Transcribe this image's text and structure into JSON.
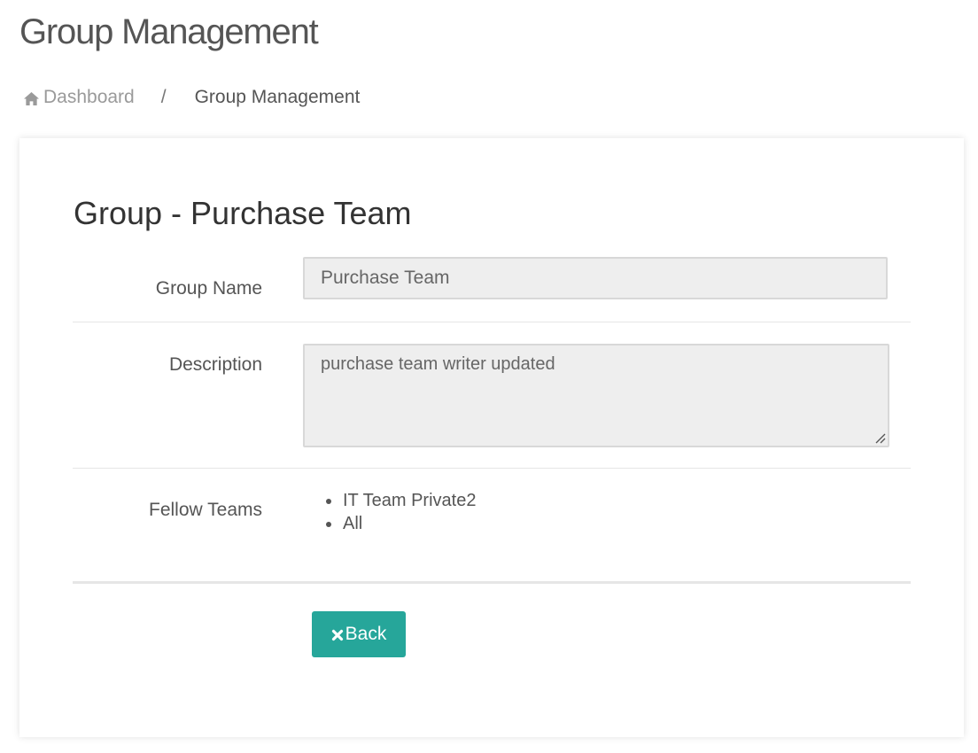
{
  "header": {
    "title": "Group Management"
  },
  "breadcrumb": {
    "home_icon": "home-icon",
    "home_label": "Dashboard",
    "separator": "/",
    "current": "Group Management"
  },
  "card": {
    "title": "Group - Purchase Team",
    "fields": {
      "group_name": {
        "label": "Group Name",
        "value": "Purchase Team"
      },
      "description": {
        "label": "Description",
        "value": "purchase team writer updated"
      },
      "fellow_teams": {
        "label": "Fellow Teams",
        "items": [
          "IT Team Private2",
          "All"
        ]
      }
    },
    "back_button": {
      "icon": "close-icon",
      "label": "Back"
    }
  },
  "colors": {
    "accent": "#26a69a",
    "input_background": "#eeeeee"
  }
}
